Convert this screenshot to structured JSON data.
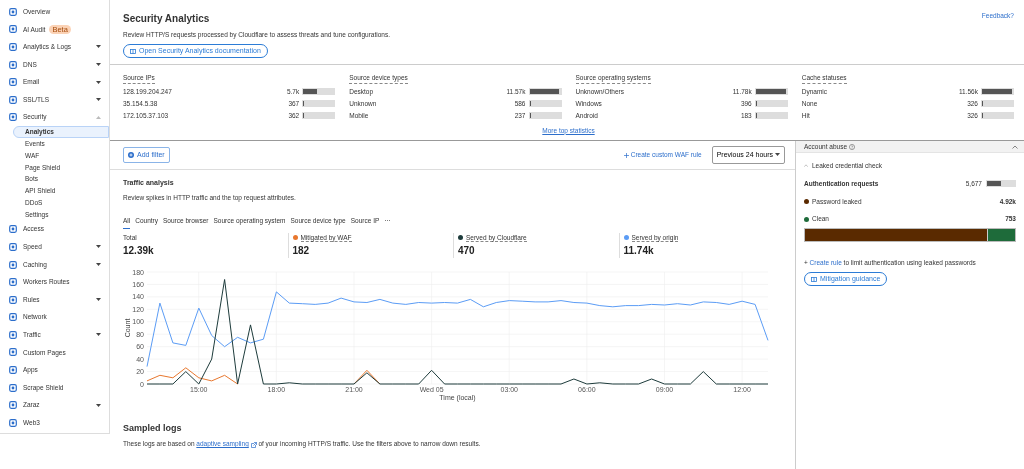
{
  "sidebar": {
    "items": [
      {
        "label": "Overview"
      },
      {
        "label": "AI Audit",
        "badge": "Beta"
      },
      {
        "label": "Analytics & Logs",
        "expanded": false
      },
      {
        "label": "DNS",
        "expanded": false
      },
      {
        "label": "Email",
        "expanded": false
      },
      {
        "label": "SSL/TLS",
        "expanded": false
      },
      {
        "label": "Security",
        "expanded": true,
        "children": [
          {
            "label": "Analytics",
            "selected": true
          },
          {
            "label": "Events",
            "selected": false
          },
          {
            "label": "WAF",
            "selected": false
          },
          {
            "label": "Page Shield",
            "selected": false
          },
          {
            "label": "Bots",
            "selected": false
          },
          {
            "label": "API Shield",
            "selected": false
          },
          {
            "label": "DDoS",
            "selected": false
          },
          {
            "label": "Settings",
            "selected": false
          }
        ]
      },
      {
        "label": "Access"
      },
      {
        "label": "Speed",
        "expanded": false
      },
      {
        "label": "Caching",
        "expanded": false
      },
      {
        "label": "Workers Routes"
      },
      {
        "label": "Rules",
        "expanded": false
      },
      {
        "label": "Network"
      },
      {
        "label": "Traffic",
        "expanded": false
      },
      {
        "label": "Custom Pages"
      },
      {
        "label": "Apps"
      },
      {
        "label": "Scrape Shield"
      },
      {
        "label": "Zaraz",
        "expanded": false
      },
      {
        "label": "Web3"
      }
    ]
  },
  "header": {
    "title": "Security Analytics",
    "description": "Review HTTP/S requests processed by Cloudflare to assess threats and tune configurations.",
    "doc_button": "Open Security Analytics documentation",
    "feedback": "Feedback?"
  },
  "top_statistics": {
    "groups": [
      {
        "title": "Source IPs",
        "rows": [
          {
            "label": "128.199.204.247",
            "value": "5.7k",
            "level": 0.45
          },
          {
            "label": "35.154.5.38",
            "value": "367",
            "level": 0.03
          },
          {
            "label": "172.105.37.103",
            "value": "362",
            "level": 0.03
          }
        ]
      },
      {
        "title": "Source device types",
        "rows": [
          {
            "label": "Desktop",
            "value": "11.57k",
            "level": 0.95
          },
          {
            "label": "Unknown",
            "value": "586",
            "level": 0.05
          },
          {
            "label": "Mobile",
            "value": "237",
            "level": 0.02
          }
        ]
      },
      {
        "title": "Source operating systems",
        "rows": [
          {
            "label": "Unknown/Others",
            "value": "11.78k",
            "level": 0.97
          },
          {
            "label": "Windows",
            "value": "396",
            "level": 0.03
          },
          {
            "label": "Android",
            "value": "183",
            "level": 0.015
          }
        ]
      },
      {
        "title": "Cache statuses",
        "rows": [
          {
            "label": "Dynamic",
            "value": "11.56k",
            "level": 0.96
          },
          {
            "label": "None",
            "value": "326",
            "level": 0.03
          },
          {
            "label": "Hit",
            "value": "326",
            "level": 0.03
          }
        ]
      }
    ],
    "more_link": "More top statistics"
  },
  "toolbar": {
    "add_filter": "Add filter",
    "create_rule": "Create custom WAF rule",
    "time_range": "Previous 24 hours"
  },
  "traffic_analysis": {
    "title": "Traffic analysis",
    "description": "Review spikes in HTTP traffic and the top request attributes.",
    "tabs": [
      {
        "label": "All",
        "selected": true
      },
      {
        "label": "Country",
        "selected": false
      },
      {
        "label": "Source browser",
        "selected": false
      },
      {
        "label": "Source operating system",
        "selected": false
      },
      {
        "label": "Source device type",
        "selected": false
      },
      {
        "label": "Source IP",
        "selected": false
      },
      {
        "label": "···",
        "selected": false
      }
    ],
    "metrics": [
      {
        "label": "Total",
        "value": "12.39k"
      },
      {
        "label": "Mitigated by WAF",
        "value": "182",
        "color": "#e8772e"
      },
      {
        "label": "Served by Cloudflare",
        "value": "470",
        "color": "#1d3b3b"
      },
      {
        "label": "Served by origin",
        "value": "11.74k",
        "color": "#5b9cf5"
      }
    ],
    "chart_data": {
      "type": "line",
      "xlabel": "Time (local)",
      "ylabel": "Count",
      "categories": [
        null,
        null,
        null,
        null,
        "15:00",
        null,
        null,
        null,
        null,
        null,
        "18:00",
        null,
        null,
        null,
        null,
        null,
        "21:00",
        null,
        null,
        null,
        null,
        null,
        "Wed 05",
        null,
        null,
        null,
        null,
        null,
        "03:00",
        null,
        null,
        null,
        null,
        null,
        "06:00",
        null,
        null,
        null,
        null,
        null,
        "09:00",
        null,
        null,
        null,
        null,
        null,
        "12:00",
        null,
        null
      ],
      "series": [
        {
          "color": "#5b9cf5",
          "values": [
            28,
            130,
            66,
            62,
            122,
            78,
            60,
            75,
            66,
            72,
            148,
            130,
            129,
            128,
            130,
            138,
            132,
            131,
            136,
            130,
            128,
            131,
            130,
            131,
            130,
            136,
            124,
            131,
            134,
            133,
            132,
            132,
            134,
            131,
            130,
            126,
            124,
            126,
            126,
            128,
            127,
            129,
            127,
            132,
            131,
            128,
            133,
            128,
            70
          ]
        },
        {
          "color": "#e8772e",
          "values": [
            5,
            14,
            10,
            26,
            10,
            5,
            14,
            0,
            null,
            null,
            null,
            null,
            null,
            null,
            null,
            null,
            0,
            22,
            0,
            null,
            null,
            null,
            null,
            null,
            null,
            null,
            null,
            null,
            null,
            null,
            null,
            null,
            null,
            null,
            null,
            null,
            null,
            null,
            null,
            null,
            null,
            null,
            null,
            null,
            null,
            null,
            null,
            null,
            null
          ]
        },
        {
          "color": "#1d3b3b",
          "values": [
            0,
            0,
            0,
            20,
            0,
            40,
            168,
            0,
            95,
            0,
            0,
            2,
            0,
            0,
            0,
            0,
            0,
            18,
            0,
            0,
            0,
            0,
            22,
            0,
            0,
            0,
            0,
            0,
            0,
            0,
            0,
            0,
            0,
            8,
            0,
            2,
            0,
            0,
            0,
            8,
            0,
            0,
            0,
            20,
            0,
            0,
            0,
            0,
            0
          ]
        }
      ],
      "ylim": [
        0,
        180
      ],
      "grid": true,
      "yticks": [
        0,
        20,
        40,
        60,
        80,
        100,
        120,
        140,
        160,
        180
      ]
    }
  },
  "sampled_logs": {
    "title": "Sampled logs",
    "text_before": "These logs are based on",
    "link": "adaptive sampling",
    "text_after": "of your incoming HTTP/S traffic. Use the filters above to narrow down results."
  },
  "account_abuse": {
    "title": "Account abuse",
    "expanded": true,
    "section": "Leaked credential check",
    "auth": {
      "label": "Authentication requests",
      "value": "5,677",
      "level": 0.5
    },
    "rows": [
      {
        "label": "Password leaked",
        "value": "4.92k",
        "color": "#5a2a00",
        "level": 0.867
      },
      {
        "label": "Clean",
        "value": "753",
        "color": "#1e6b3a",
        "level": 0.133
      }
    ],
    "create_prefix": "+",
    "create_link": "Create rule",
    "create_text": "to limit authentication using leaked passwords",
    "guidance_button": "Mitigation guidance"
  }
}
